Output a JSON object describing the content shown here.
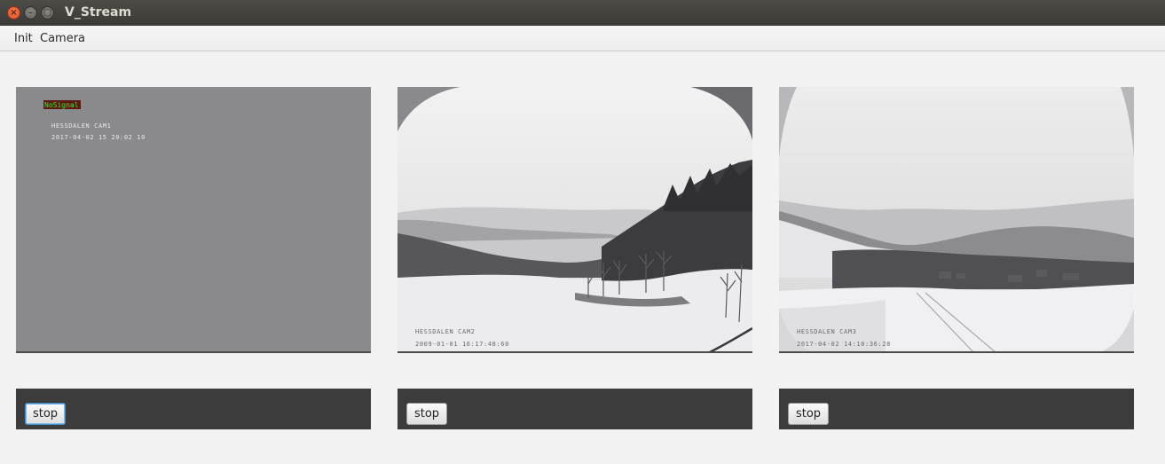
{
  "window": {
    "title": "V_Stream"
  },
  "menu": {
    "items": [
      "Init",
      "Camera"
    ]
  },
  "cameras": [
    {
      "status_badge": "NoSignal",
      "osd_name": "HESSDALEN CAM1",
      "osd_time": "2017-04-02 15 20:02 10",
      "stop_label": "stop"
    },
    {
      "osd_name": "HESSDALEN CAM2",
      "osd_time": "2009-01-01 16:17:48:60",
      "stop_label": "stop"
    },
    {
      "osd_name": "HESSDALEN CAM3",
      "osd_time": "2017-04-02 14:10:36:28",
      "stop_label": "stop"
    }
  ],
  "colors": {
    "nosignal_bg": "#8a8a8d",
    "control_bar": "#3c3c3c",
    "badge_bg": "#5c1a10",
    "badge_text": "#3fe23f"
  }
}
